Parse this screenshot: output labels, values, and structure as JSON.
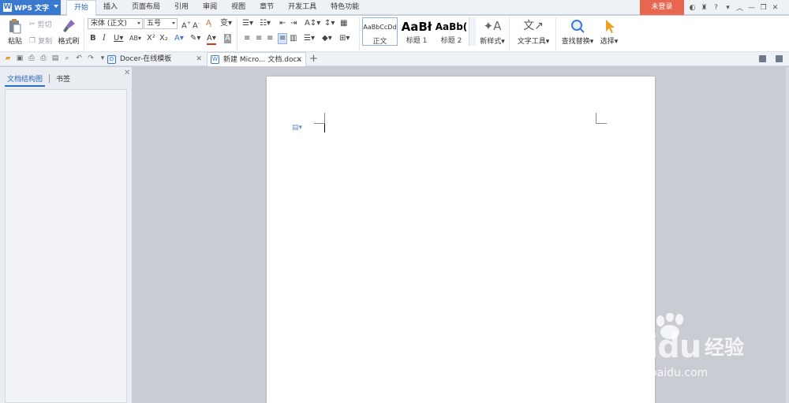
{
  "app": {
    "name": "WPS 文字",
    "login": "未登录"
  },
  "menu": {
    "tabs": [
      "开始",
      "插入",
      "页面布局",
      "引用",
      "审阅",
      "视图",
      "章节",
      "开发工具",
      "特色功能"
    ],
    "active": 0
  },
  "ribbon": {
    "paste": "粘贴",
    "cut": "剪切",
    "copy": "复制",
    "format_painter": "格式刷",
    "font_name": "宋体 (正文)",
    "font_size": "五号",
    "styles": [
      {
        "sample": "AaBbCcDd",
        "label": "正文"
      },
      {
        "sample": "AaBł",
        "label": "标题 1"
      },
      {
        "sample": "AaBb(",
        "label": "标题 2"
      }
    ],
    "new_style": "新样式",
    "text_tools": "文字工具",
    "find_replace": "查找替换",
    "select": "选择"
  },
  "doc_tabs": [
    {
      "label": "Docer-在线模板",
      "active": false
    },
    {
      "label": "新建 Micro... 文档.docx",
      "active": true
    }
  ],
  "nav": {
    "tabs": [
      "文档结构图",
      "书签"
    ],
    "active": 0
  },
  "watermark": {
    "logo": "Baidu",
    "cn": "经验",
    "url": "jingyan.baidu.com"
  }
}
